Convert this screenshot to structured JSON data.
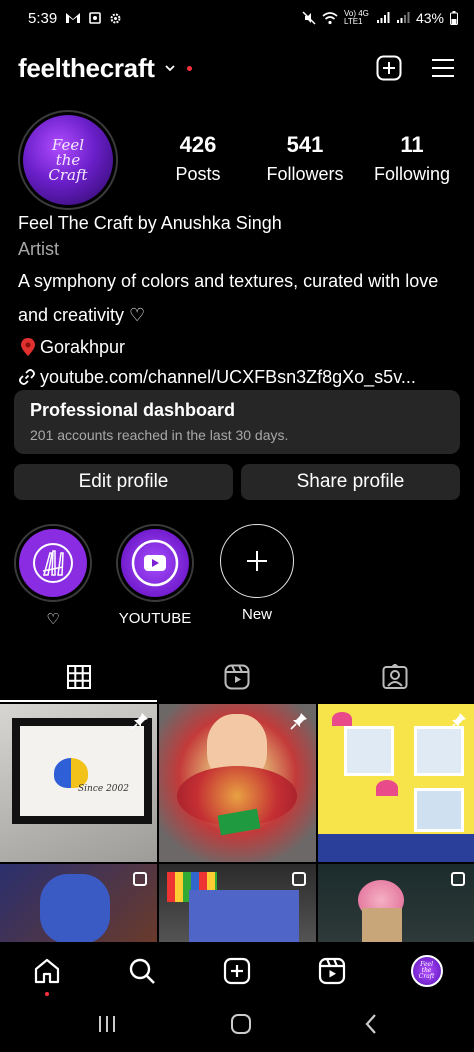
{
  "status_bar": {
    "time": "5:39",
    "battery": "43%",
    "net_label": "Vo) 4G LTE1"
  },
  "header": {
    "username": "feelthecraft"
  },
  "profile": {
    "avatar_text": "Feel the Craft",
    "stats": [
      {
        "value": "426",
        "label": "Posts"
      },
      {
        "value": "541",
        "label": "Followers"
      },
      {
        "value": "11",
        "label": "Following"
      }
    ]
  },
  "bio": {
    "name": "Feel The Craft by Anushka Singh",
    "category": "Artist",
    "text": "A symphony of colors and textures, curated with love and creativity ♡",
    "location": "Gorakhpur",
    "link": "youtube.com/channel/UCXFBsn3Zf8gXo_s5v..."
  },
  "dashboard": {
    "title": "Professional dashboard",
    "subtitle": "201 accounts reached in the last 30 days."
  },
  "buttons": {
    "edit": "Edit profile",
    "share": "Share profile"
  },
  "highlights": [
    {
      "label": "♡"
    },
    {
      "label": "YOUTUBE"
    },
    {
      "label": "New"
    }
  ],
  "grid_images": {
    "post1_text": "Since 2002"
  },
  "colors": {
    "accent_purple": "#8a2ce2",
    "notification_red": "#ff3040",
    "surface": "#262626"
  }
}
